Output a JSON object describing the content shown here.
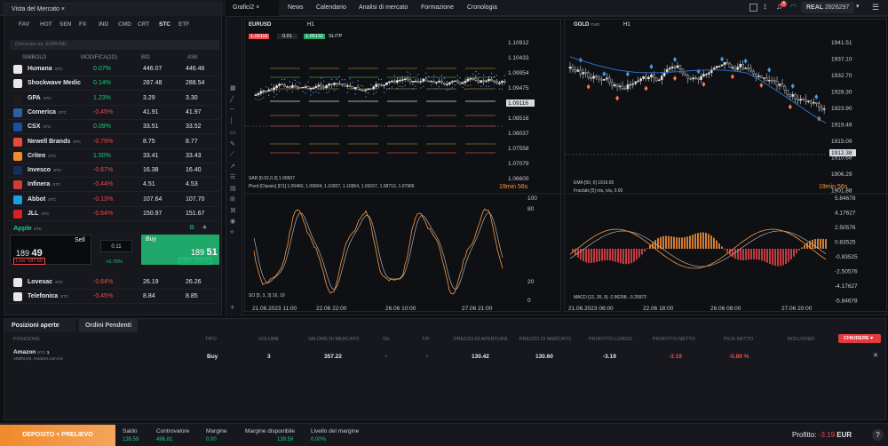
{
  "watchlist": {
    "title": "Vista del Mercato",
    "tabs": [
      "FAV",
      "HOT",
      "SEN",
      "FX",
      "IND",
      "CMD",
      "CRT",
      "STC",
      "ETF"
    ],
    "active_tab": "STC",
    "search_placeholder": "Cerca per es. EURUSD",
    "columns": [
      "SIMBOLO",
      "MODIFICA(1D)",
      "BID",
      "ASK"
    ],
    "rows": [
      {
        "name": "Humana",
        "tag": "STC",
        "change": "0.07%",
        "bid": "446.07",
        "ask": "446.46",
        "dir": "pos"
      },
      {
        "name": "Shockwave Medic",
        "tag": "",
        "change": "0.14%",
        "bid": "287.48",
        "ask": "288.54",
        "dir": "pos"
      },
      {
        "name": "GPA",
        "tag": "STC",
        "change": "1.23%",
        "bid": "3.29",
        "ask": "3.30",
        "dir": "pos"
      },
      {
        "name": "Comerica",
        "tag": "STC",
        "change": "-0.45%",
        "bid": "41.91",
        "ask": "41.97",
        "dir": "neg"
      },
      {
        "name": "CSX",
        "tag": "STC",
        "change": "0.09%",
        "bid": "33.51",
        "ask": "33.52",
        "dir": "pos"
      },
      {
        "name": "Newell Brands",
        "tag": "STC",
        "change": "-0.79%",
        "bid": "8.75",
        "ask": "8.77",
        "dir": "neg"
      },
      {
        "name": "Criteo",
        "tag": "STC",
        "change": "1.50%",
        "bid": "33.41",
        "ask": "33.43",
        "dir": "pos"
      },
      {
        "name": "Invesco",
        "tag": "STC",
        "change": "-0.67%",
        "bid": "16.38",
        "ask": "16.40",
        "dir": "neg"
      },
      {
        "name": "Infinera",
        "tag": "STC",
        "change": "-0.44%",
        "bid": "4.51",
        "ask": "4.53",
        "dir": "neg"
      },
      {
        "name": "Abbot",
        "tag": "STC",
        "change": "-0.13%",
        "bid": "107.64",
        "ask": "107.70",
        "dir": "neg"
      },
      {
        "name": "JLL",
        "tag": "STC",
        "change": "-0.64%",
        "bid": "150.97",
        "ask": "151.67",
        "dir": "neg"
      }
    ],
    "rows_below": [
      {
        "name": "Lovesac",
        "tag": "STC",
        "change": "-0.64%",
        "bid": "26.19",
        "ask": "26.26",
        "dir": "neg"
      },
      {
        "name": "Telefonica",
        "tag": "STC",
        "change": "-0.45%",
        "bid": "8.84",
        "ask": "8.85",
        "dir": "neg"
      }
    ],
    "trade": {
      "symbol": "Apple",
      "tag": "STC",
      "sell_label": "Sell",
      "sell_price_main": "189",
      "sell_price_big": "49",
      "buy_label": "Buy",
      "buy_price_main": "189",
      "buy_price_big": "51",
      "volume": "0.11",
      "change": "+0.76%",
      "low": "Low: 187.60",
      "high": "High: 189.41"
    }
  },
  "top": {
    "chart_tab": "Grafici2",
    "tabs": [
      "News",
      "Calendario",
      "Analisi di mercato",
      "Formazione",
      "Cronologia"
    ],
    "account_type": "REAL",
    "account_number": "2826297",
    "notif_count": "4"
  },
  "left_chart": {
    "symbol": "EURUSD",
    "timeframe": "H1",
    "price_box": "1.09116",
    "bid": "1.09116",
    "ask": "1.09132",
    "volume": "0.01",
    "sltp": "SL/TP",
    "y_labels": [
      "1.10912",
      "1.10433",
      "1.09954",
      "1.09475",
      "1.09116",
      "1.08516",
      "1.08037",
      "1.07558",
      "1.07079",
      "1.06600"
    ],
    "osc_labels": [
      "100",
      "80",
      "20",
      "0"
    ],
    "x_labels": [
      "21.06.2023 11:00",
      "22.06 22:00",
      "26.06 10:00",
      "27.06 21:00"
    ],
    "legend1": "SAR [0.02,0.2] 1.09507",
    "legend2": "Pivot [Classic] [D1] 1.09460, 1.09904, 1.10207, 1.10954, 1.09157, 1.08713, 1.07966",
    "legend3": "SO [5, 3, 3] 16, 19",
    "countdown": "19min 56s"
  },
  "right_chart": {
    "symbol": "GOLD",
    "tag": "CMD",
    "timeframe": "H1",
    "price_box": "1912.38",
    "y_labels": [
      "1941.51",
      "1937.10",
      "1932.70",
      "1928.30",
      "1923.90",
      "1919.49",
      "1915.09",
      "1910.69",
      "1906.29",
      "1901.88"
    ],
    "osc_labels": [
      "5.84678",
      "4.17627",
      "2.50576",
      "0.83525",
      "-0.83525",
      "-2.50576",
      "-4.17627",
      "-5.84678"
    ],
    "x_labels": [
      "21.06.2023 06:00",
      "22.06 18:00",
      "26.06 08:00",
      "27.06 20:00"
    ],
    "legend1": "EMA [50, 0] 1916.65",
    "legend2": "Fractals [5] n/a, n/a, 0.00",
    "legend3": "MACD [12, 26, 9] -2.96298, -3.25972",
    "countdown": "19min 56s"
  },
  "positions": {
    "tabs": [
      "Posizioni aperte",
      "Ordini Pendenti"
    ],
    "columns": [
      "POSIZIONE",
      "TIPO",
      "VOLUME",
      "VALORE DI MERCATO",
      "S/L",
      "T/P",
      "PREZZO DI APERTURA",
      "PREZZO DI MERCATO",
      "PROFITTO LORDO",
      "PROFITTO NETTO",
      "P/L% NETTO",
      "ROLLOVER"
    ],
    "close_label": "CHIUDERE",
    "row": {
      "name": "Amazon",
      "tag": "STC",
      "sub": "AMZN.US, Amazon.com Inc",
      "type": "Buy",
      "volume": "3",
      "market_value": "357.22",
      "sl": "+",
      "tp": "+",
      "open_price": "130.42",
      "market_price": "130.60",
      "gross": "-3.19",
      "net": "-3.19",
      "pl_pct": "-0.89 %"
    }
  },
  "footer": {
    "deposit_label": "DEPOSITO + PRELIEVO",
    "saldo_label": "Saldo",
    "saldo": "139.59",
    "contr_label": "Controvalore",
    "contr": "496.81",
    "margin_label": "Margine",
    "margin": "0.00",
    "free_label": "Margine disponibile",
    "free": "139.59",
    "level_label": "Livello del margine",
    "level": "0.00%",
    "profit_label": "Profitto:",
    "profit": "-3.19",
    "currency": "EUR"
  },
  "colors": {
    "green": "#1fc77f",
    "red": "#f2484b",
    "orange": "#ff9a3c",
    "blue": "#2f6ec4",
    "candle_up": "#e8e8e8"
  }
}
